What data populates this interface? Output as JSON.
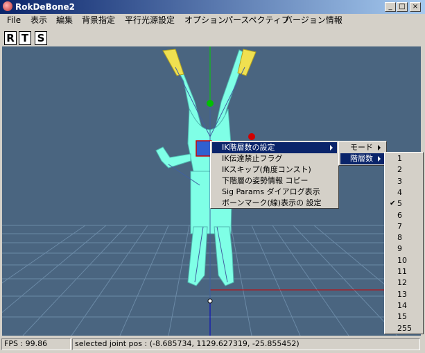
{
  "window": {
    "title": "RokDeBone2",
    "minimize": "_",
    "maximize": "□",
    "close": "×"
  },
  "menubar": [
    "File",
    "表示",
    "編集",
    "背景指定",
    "平行光源設定",
    "オプション",
    "パースペクティブ",
    "バージョン情報"
  ],
  "toolbar": {
    "buttons": [
      "R",
      "T",
      "S"
    ]
  },
  "context_menu": {
    "items": [
      {
        "label": "IK階層数の設定",
        "submenu": true,
        "selected": true
      },
      {
        "label": "IK伝達禁止フラグ"
      },
      {
        "label": "IKスキップ(角度コンスト)"
      },
      {
        "label": "下階層の姿勢情報 コピー"
      },
      {
        "label": "Sig Params ダイアログ表示"
      },
      {
        "label": "ボーンマーク(線)表示の 設定"
      }
    ]
  },
  "submenu": {
    "items": [
      {
        "label": "モード",
        "submenu": true
      },
      {
        "label": "階層数",
        "submenu": true,
        "selected": true
      }
    ]
  },
  "levels": {
    "items": [
      "1",
      "2",
      "3",
      "4",
      "5",
      "6",
      "7",
      "8",
      "9",
      "10",
      "11",
      "12",
      "13",
      "14",
      "15",
      "255"
    ],
    "checked": "5"
  },
  "status": {
    "fps": "FPS : 99.86",
    "joint": "selected joint pos : (-8.685734, 1129.627319, -25.855452)"
  },
  "colors": {
    "titlebar_start": "#0a246a",
    "viewport_bg": "#4a6580",
    "model": "#7fffe6",
    "selection": "#0a246a"
  }
}
